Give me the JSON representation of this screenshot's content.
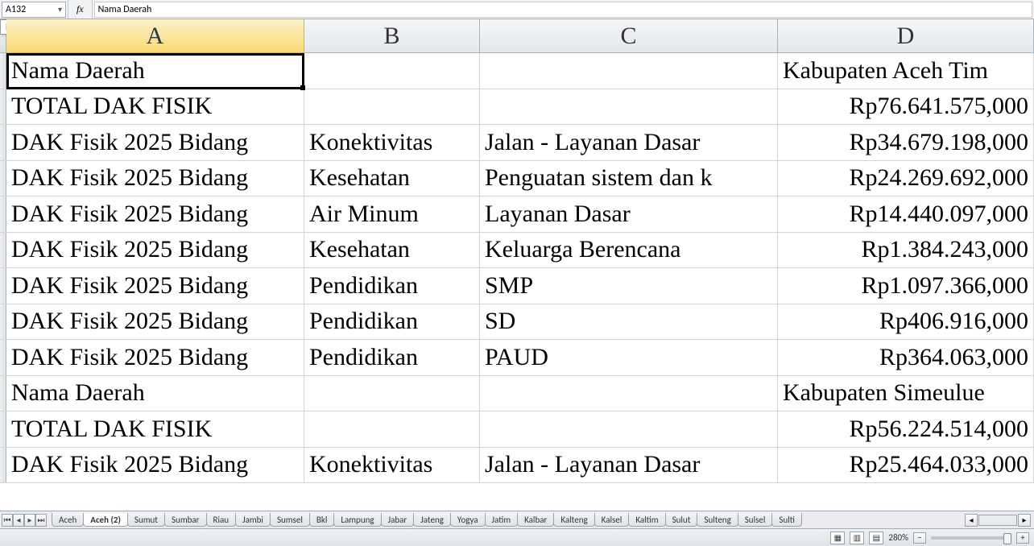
{
  "formula_bar": {
    "name_box": "A132",
    "name_box_tooltip": "Name Box",
    "fx_label": "fx",
    "formula": "Nama Daerah"
  },
  "columns": [
    "A",
    "B",
    "C",
    "D"
  ],
  "active_column_index": 0,
  "active_cell": "A132",
  "rows": [
    {
      "A": "Nama Daerah",
      "B": "",
      "C": "",
      "D": "Kabupaten Aceh Tim",
      "D_align": "left"
    },
    {
      "A": "TOTAL DAK FISIK",
      "B": "",
      "C": "",
      "D": "Rp76.641.575,000",
      "D_align": "right"
    },
    {
      "A": "DAK Fisik 2025 Bidang",
      "B": "Konektivitas",
      "C": "Jalan - Layanan Dasar",
      "D": "Rp34.679.198,000",
      "D_align": "right"
    },
    {
      "A": "DAK Fisik 2025 Bidang",
      "B": "Kesehatan",
      "C": "Penguatan sistem dan k",
      "D": "Rp24.269.692,000",
      "D_align": "right"
    },
    {
      "A": "DAK Fisik 2025 Bidang",
      "B": "Air Minum",
      "C": "Layanan Dasar",
      "D": "Rp14.440.097,000",
      "D_align": "right"
    },
    {
      "A": "DAK Fisik 2025 Bidang",
      "B": "Kesehatan",
      "C": "Keluarga Berencana",
      "D": "Rp1.384.243,000",
      "D_align": "right"
    },
    {
      "A": "DAK Fisik 2025 Bidang",
      "B": "Pendidikan",
      "C": "SMP",
      "D": "Rp1.097.366,000",
      "D_align": "right"
    },
    {
      "A": "DAK Fisik 2025 Bidang",
      "B": "Pendidikan",
      "C": "SD",
      "D": "Rp406.916,000",
      "D_align": "right"
    },
    {
      "A": "DAK Fisik 2025 Bidang",
      "B": "Pendidikan",
      "C": "PAUD",
      "D": "Rp364.063,000",
      "D_align": "right"
    },
    {
      "A": "Nama Daerah",
      "B": "",
      "C": "",
      "D": "Kabupaten Simeulue",
      "D_align": "left"
    },
    {
      "A": "TOTAL DAK FISIK",
      "B": "",
      "C": "",
      "D": "Rp56.224.514,000",
      "D_align": "right"
    },
    {
      "A": "DAK Fisik 2025 Bidang",
      "B": "Konektivitas",
      "C": "Jalan - Layanan Dasar",
      "D": "Rp25.464.033,000",
      "D_align": "right"
    }
  ],
  "sheet_tabs": {
    "items": [
      "Aceh",
      "Aceh (2)",
      "Sumut",
      "Sumbar",
      "Riau",
      "Jambi",
      "Sumsel",
      "Bkl",
      "Lampung",
      "Jabar",
      "Jateng",
      "Yogya",
      "Jatim",
      "Kalbar",
      "Kalteng",
      "Kalsel",
      "Kaltim",
      "Sulut",
      "Sulteng",
      "Sulsel",
      "Sulti"
    ],
    "active_index": 1
  },
  "status_bar": {
    "zoom": "280%",
    "view_icons": [
      "normal",
      "page-layout",
      "page-break"
    ]
  }
}
